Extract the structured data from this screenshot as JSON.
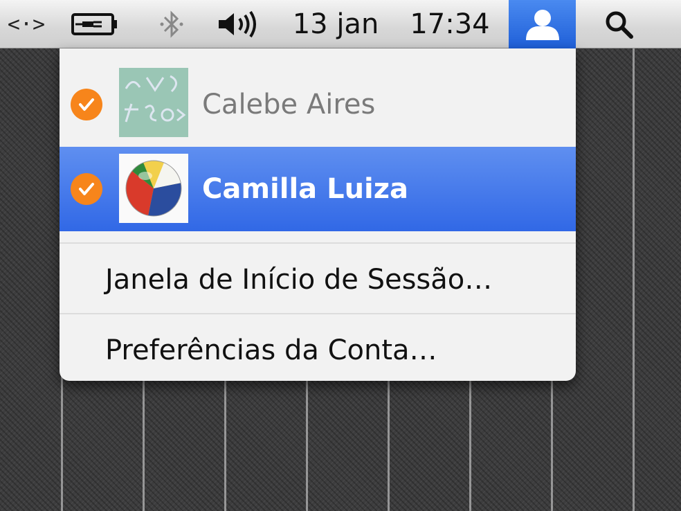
{
  "menubar": {
    "icons": {
      "network": "network-arrows-icon",
      "battery": "battery-plugged-icon",
      "bluetooth": "bluetooth-icon",
      "volume": "volume-icon",
      "user": "user-silhouette-icon",
      "search": "spotlight-search-icon"
    },
    "date": "13 jan",
    "time": "17:34"
  },
  "menu": {
    "users": [
      {
        "name": "Calebe Aires",
        "checked": true,
        "selected": false,
        "avatar": "chalkboard-avatar-icon"
      },
      {
        "name": "Camilla Luiza",
        "checked": true,
        "selected": true,
        "avatar": "beach-ball-avatar-icon"
      }
    ],
    "login_window": "Janela de Início de Sessão…",
    "account_prefs": "Preferências da Conta…"
  },
  "colors": {
    "selection": "#3a6fe6",
    "check": "#f7851b",
    "user_button": "#2f6fdc"
  }
}
